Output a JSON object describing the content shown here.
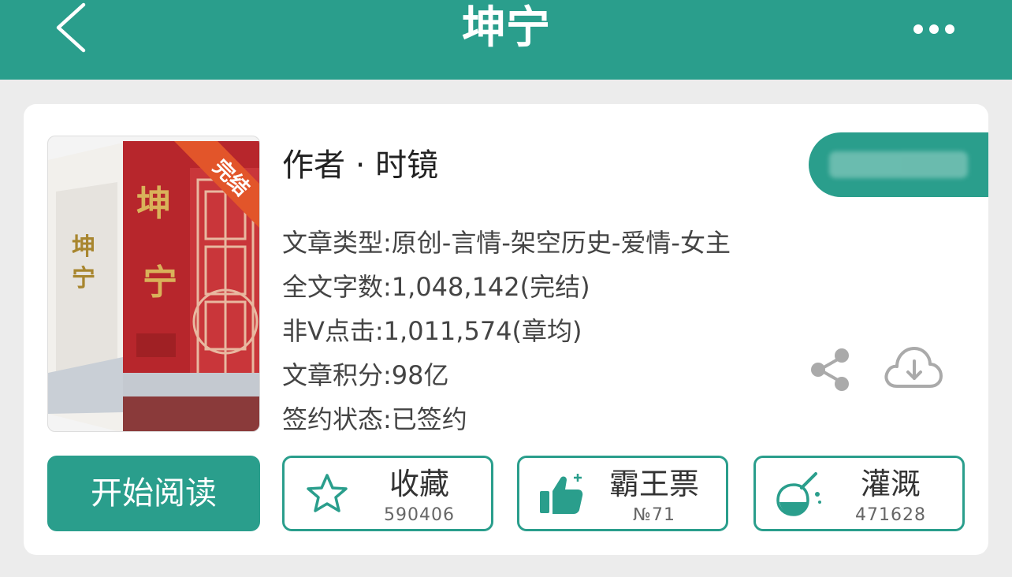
{
  "header": {
    "title": "坤宁",
    "back_icon": "chevron-left-icon",
    "more_icon": "more-horizontal-icon",
    "background": "#2a9e8c"
  },
  "book": {
    "cover_badge": "完结",
    "cover_title": "坤宁",
    "author_line": "作者 · 时镜",
    "info": [
      "文章类型:原创-言情-架空历史-爱情-女主",
      "全文字数:1,048,142(完结)",
      "非V点击:1,011,574(章均)",
      "文章积分:98亿",
      "签约状态:已签约"
    ]
  },
  "icons": {
    "share": "share-icon",
    "download": "cloud-download-icon"
  },
  "actions": {
    "read_label": "开始阅读",
    "favorite": {
      "label": "收藏",
      "count": "590406",
      "icon": "star-icon"
    },
    "vote": {
      "label": "霸王票",
      "count": "№71",
      "icon": "thumbs-up-icon"
    },
    "irrigate": {
      "label": "灌溉",
      "count": "471628",
      "icon": "flask-icon"
    }
  },
  "colors": {
    "accent": "#2a9e8c",
    "cover_red": "#b7262c",
    "badge_orange": "#e2552a"
  }
}
